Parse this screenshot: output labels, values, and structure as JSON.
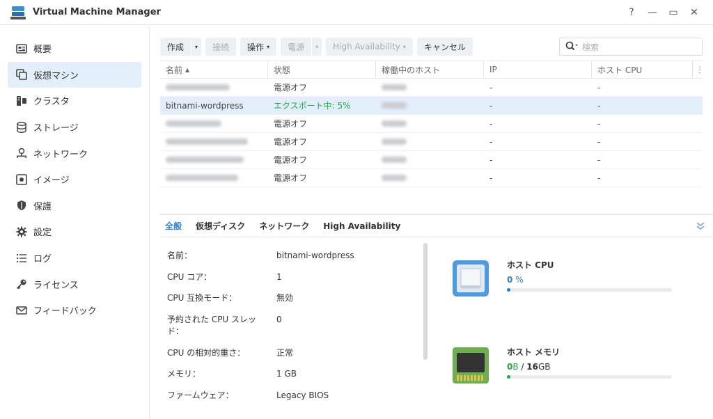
{
  "window": {
    "title": "Virtual Machine Manager",
    "controls": [
      "?",
      "—",
      "▭",
      "✕"
    ]
  },
  "sidebar": {
    "items": [
      {
        "label": "概要",
        "icon": "overview-icon"
      },
      {
        "label": "仮想マシン",
        "icon": "virtual-machine-icon",
        "active": true
      },
      {
        "label": "クラスタ",
        "icon": "cluster-icon"
      },
      {
        "label": "ストレージ",
        "icon": "storage-icon"
      },
      {
        "label": "ネットワーク",
        "icon": "network-icon"
      },
      {
        "label": "イメージ",
        "icon": "image-icon"
      },
      {
        "label": "保護",
        "icon": "shield-icon"
      },
      {
        "label": "設定",
        "icon": "gear-icon"
      },
      {
        "label": "ログ",
        "icon": "log-icon"
      },
      {
        "label": "ライセンス",
        "icon": "key-icon"
      },
      {
        "label": "フィードバック",
        "icon": "mail-icon"
      }
    ]
  },
  "toolbar": {
    "create": "作成",
    "connect": "接続",
    "action": "操作",
    "power": "電源",
    "ha": "High Availability",
    "cancel": "キャンセル",
    "search_placeholder": "検索"
  },
  "grid": {
    "columns": [
      "名前",
      "状態",
      "稼働中のホスト",
      "IP",
      "ホスト CPU"
    ],
    "rows": [
      {
        "name": "",
        "status": "電源オフ",
        "ip": "-",
        "cpu": "-"
      },
      {
        "name": "bitnami-wordpress",
        "status": "エクスポート中: 5%",
        "ip": "-",
        "cpu": "-"
      },
      {
        "name": "",
        "status": "電源オフ",
        "ip": "-",
        "cpu": "-"
      },
      {
        "name": "",
        "status": "電源オフ",
        "ip": "-",
        "cpu": "-"
      },
      {
        "name": "",
        "status": "電源オフ",
        "ip": "-",
        "cpu": "-"
      },
      {
        "name": "",
        "status": "電源オフ",
        "ip": "-",
        "cpu": "-"
      }
    ]
  },
  "detail": {
    "tabs": [
      "全般",
      "仮想ディスク",
      "ネットワーク",
      "High Availability"
    ],
    "props": [
      {
        "key": "名前：",
        "value": "bitnami-wordpress"
      },
      {
        "key": "CPU コア：",
        "value": "1"
      },
      {
        "key": "CPU 互換モード：",
        "value": "無効"
      },
      {
        "key": "予約された CPU スレッド：",
        "value": "0"
      },
      {
        "key": "CPU の相対的重さ：",
        "value": "正常"
      },
      {
        "key": "メモリ：",
        "value": "1 GB"
      },
      {
        "key": "ファームウェア：",
        "value": "Legacy BIOS"
      }
    ],
    "host_cpu": {
      "title": "ホスト CPU",
      "value": "0",
      "unit": "%",
      "fraction": 0.02
    },
    "host_mem": {
      "title": "ホスト メモリ",
      "used": "0",
      "used_unit": "B",
      "sep": " / ",
      "total": "16",
      "total_unit": "GB",
      "fraction": 0.02
    }
  }
}
